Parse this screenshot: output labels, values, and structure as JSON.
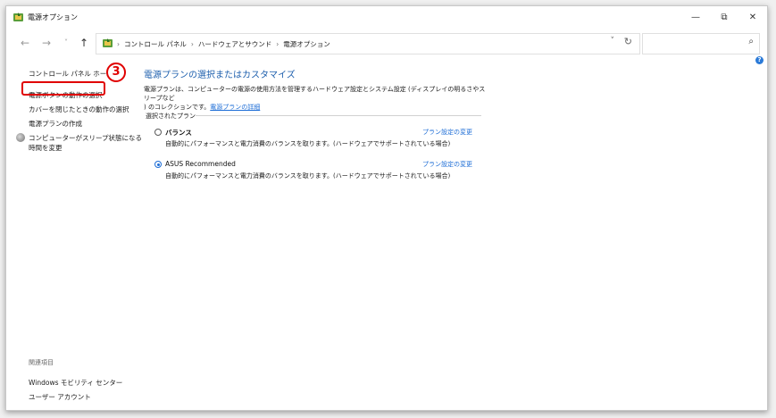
{
  "window": {
    "title": "電源オプション"
  },
  "titlebar": {
    "minimize": "—",
    "maximize": "⧉",
    "close": "✕"
  },
  "nav": {
    "back": "←",
    "forward": "→",
    "dropdown": "˅",
    "up": "↑"
  },
  "address": {
    "crumbs": [
      "コントロール パネル",
      "ハードウェアとサウンド",
      "電源オプション"
    ],
    "separator": "›",
    "leading_separator": "›",
    "dropdown": "˅",
    "refresh": "↻"
  },
  "search": {
    "placeholder": "",
    "icon": "⌕"
  },
  "help": {
    "label": "?"
  },
  "left": {
    "home": "コントロール パネル ホーム",
    "links": [
      "電源ボタンの動作の選択",
      "カバーを閉じたときの動作の選択",
      "電源プランの作成"
    ],
    "sleep_link_line1": "コンピューターがスリープ状態になる",
    "sleep_link_line2": "時間を変更",
    "step_badge": "3",
    "related_heading": "関連項目",
    "related": [
      "Windows モビリティ センター",
      "ユーザー アカウント"
    ]
  },
  "main": {
    "title": "電源プランの選択またはカスタマイズ",
    "desc_line1": "電源プランは、コンピューターの電源の使用方法を管理するハードウェア設定とシステム設定 (ディスプレイの明るさやスリープなど",
    "desc_line2": ") のコレクションです。",
    "desc_link": "電源プランの詳細",
    "section_label": "選択されたプラン",
    "plans": [
      {
        "name": "バランス",
        "desc": "自動的にパフォーマンスと電力消費のバランスを取ります。(ハードウェアでサポートされている場合)",
        "change": "プラン設定の変更",
        "selected": false
      },
      {
        "name": "ASUS Recommended",
        "desc": "自動的にパフォーマンスと電力消費のバランスを取ります。(ハードウェアでサポートされている場合)",
        "change": "プラン設定の変更",
        "selected": true
      }
    ]
  },
  "colors": {
    "accent": "#1d6dd6",
    "title": "#1d5fad",
    "highlight": "#e00000"
  }
}
